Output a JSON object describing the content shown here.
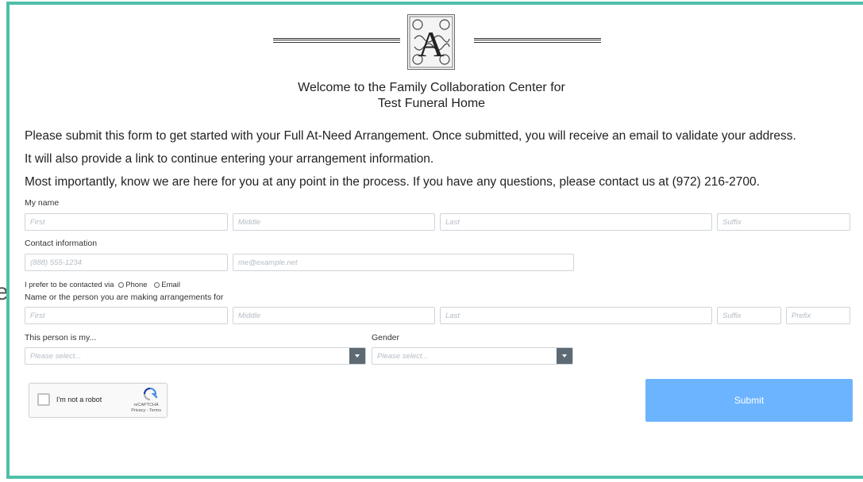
{
  "edge_letter": "e",
  "header": {
    "welcome_line1": "Welcome to the Family Collaboration Center for",
    "welcome_line2": "Test Funeral Home"
  },
  "intro": {
    "p1": "Please submit this form to get started with your Full At-Need Arrangement. Once submitted, you will receive an email to validate your address.",
    "p2": "It will also provide a link to continue entering your arrangement information.",
    "p3": "Most importantly, know we are here for you at any point in the process. If you have any questions, please contact us at (972) 216-2700."
  },
  "my_name": {
    "label": "My name",
    "first_placeholder": "First",
    "middle_placeholder": "Middle",
    "last_placeholder": "Last",
    "suffix_placeholder": "Suffix"
  },
  "contact": {
    "label": "Contact information",
    "phone_placeholder": "(888) 555-1234",
    "email_placeholder": "me@example.net",
    "prefer_label": "I prefer to be contacted via",
    "option_phone": "Phone",
    "option_email": "Email"
  },
  "deceased": {
    "label": "Name or the person you are making arrangements for",
    "first_placeholder": "First",
    "middle_placeholder": "Middle",
    "last_placeholder": "Last",
    "suffix_placeholder": "Suffix",
    "prefix_placeholder": "Prefix"
  },
  "relation": {
    "label": "This person is my...",
    "selected": "Please select..."
  },
  "gender": {
    "label": "Gender",
    "selected": "Please select..."
  },
  "captcha": {
    "label": "I'm not a robot",
    "brand": "reCAPTCHA",
    "links": "Privacy - Terms"
  },
  "submit_label": "Submit",
  "colors": {
    "frame": "#4fbfa8",
    "submit": "#6cb4ff",
    "select_button": "#5d6a74"
  }
}
